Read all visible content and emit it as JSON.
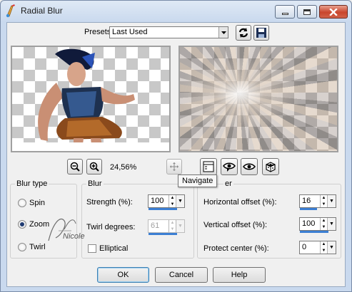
{
  "window": {
    "title": "Radial Blur"
  },
  "presets": {
    "label": "Presets:",
    "value": "Last Used"
  },
  "zoom": {
    "level": "24,56%"
  },
  "tooltip": {
    "text": "Navigate"
  },
  "blur_type": {
    "title": "Blur type",
    "options": [
      {
        "label": "Spin",
        "selected": false
      },
      {
        "label": "Zoom",
        "selected": true
      },
      {
        "label": "Twirl",
        "selected": false
      }
    ]
  },
  "blur": {
    "title": "Blur",
    "strength_label": "Strength (%):",
    "strength_value": "100",
    "strength_fill": 1.0,
    "twirl_label": "Twirl degrees:",
    "twirl_value": "61",
    "twirl_fill": 1.0,
    "elliptical_label": "Elliptical",
    "elliptical_checked": false
  },
  "center": {
    "title_visible": "er",
    "h_offset_label": "Horizontal offset (%):",
    "h_offset_value": "16",
    "h_offset_fill": 0.6,
    "v_offset_label": "Vertical offset (%):",
    "v_offset_value": "100",
    "v_offset_fill": 1.0,
    "protect_label": "Protect center (%):",
    "protect_value": "0",
    "protect_fill": 0.0
  },
  "watermark": {
    "text": "Nicole"
  },
  "buttons": {
    "ok": "OK",
    "cancel": "Cancel",
    "help": "Help"
  },
  "colors": {
    "accent": "#3c7fd3",
    "close": "#c9452c"
  }
}
